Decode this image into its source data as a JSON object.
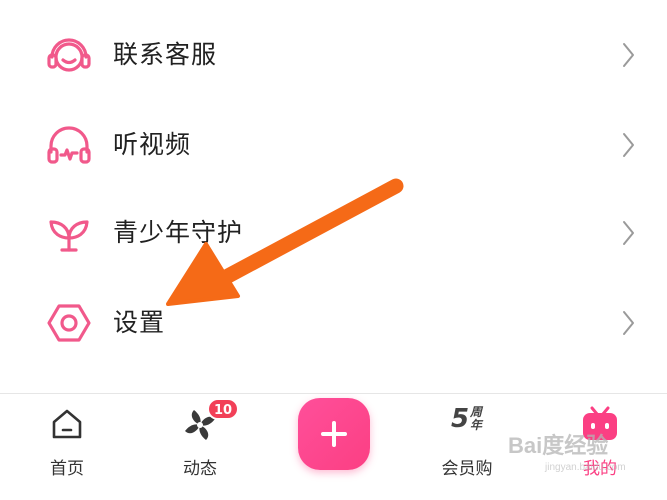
{
  "menu": {
    "items": [
      {
        "label": "联系客服",
        "icon": "customer-service-headset-icon"
      },
      {
        "label": "听视频",
        "icon": "headphones-icon"
      },
      {
        "label": "青少年守护",
        "icon": "sprout-icon"
      },
      {
        "label": "设置",
        "icon": "hexagon-settings-icon"
      }
    ]
  },
  "tabbar": {
    "home_label": "首页",
    "home_icon": "house-icon",
    "dynamic_label": "动态",
    "dynamic_icon": "pinwheel-icon",
    "dynamic_badge": "10",
    "publish_icon": "plus-icon",
    "vip_label": "会员购",
    "vip_icon_number": "5",
    "vip_icon_text": "周年",
    "mine_label": "我的",
    "mine_icon": "tv-icon"
  },
  "watermark": {
    "text": "Bai度经验",
    "sub": "jingyan.baidu.com"
  },
  "colors": {
    "accent_pink": "#fb3f83",
    "icon_pink": "#f1598b",
    "arrow_orange": "#f56a17",
    "badge_red": "#f24058"
  }
}
